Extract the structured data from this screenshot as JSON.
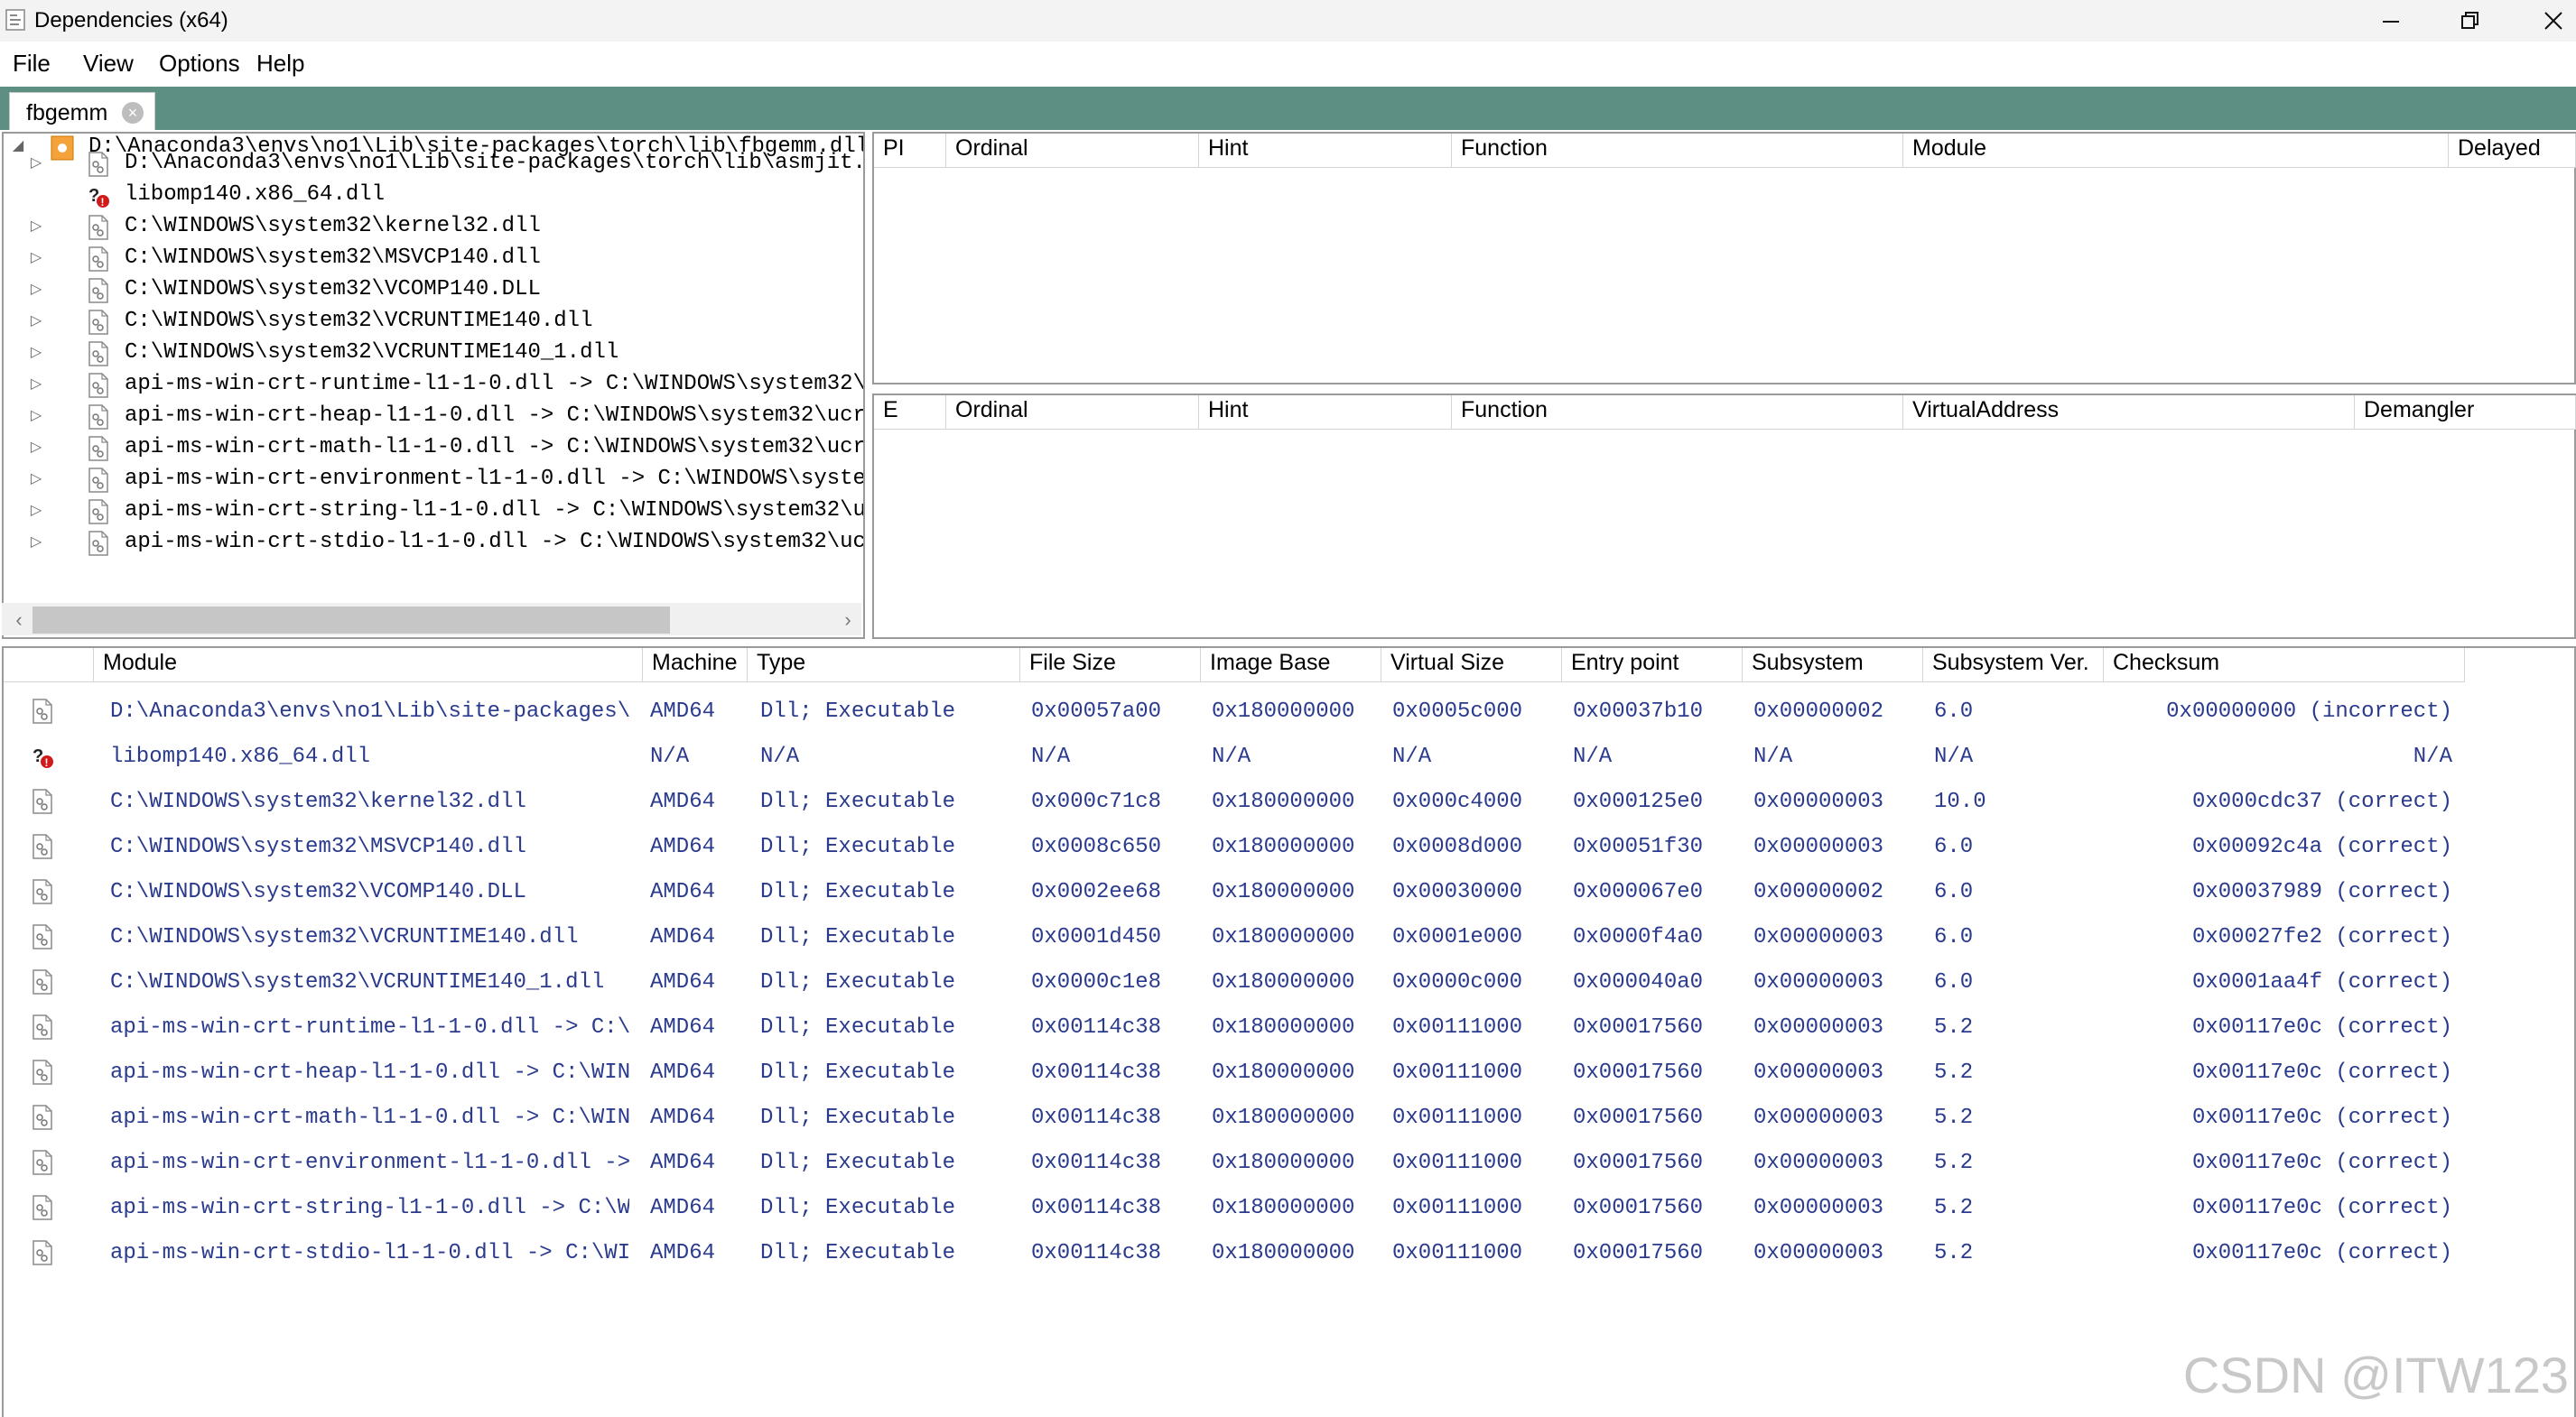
{
  "window": {
    "title": "Dependencies (x64)",
    "buttons": {
      "minimize": "—",
      "restore": "❐",
      "close": "✕"
    }
  },
  "menu": [
    "File",
    "View",
    "Options",
    "Help"
  ],
  "tab": {
    "label": "fbgemm"
  },
  "tree": {
    "root": "D:\\Anaconda3\\envs\\no1\\Lib\\site-packages\\torch\\lib\\fbgemm.dll",
    "children": [
      {
        "text": "D:\\Anaconda3\\envs\\no1\\Lib\\site-packages\\torch\\lib\\asmjit.",
        "expandable": true,
        "missing": false
      },
      {
        "text": "libomp140.x86_64.dll",
        "expandable": false,
        "missing": true
      },
      {
        "text": "C:\\WINDOWS\\system32\\kernel32.dll",
        "expandable": true,
        "missing": false
      },
      {
        "text": "C:\\WINDOWS\\system32\\MSVCP140.dll",
        "expandable": true,
        "missing": false
      },
      {
        "text": "C:\\WINDOWS\\system32\\VCOMP140.DLL",
        "expandable": true,
        "missing": false
      },
      {
        "text": "C:\\WINDOWS\\system32\\VCRUNTIME140.dll",
        "expandable": true,
        "missing": false
      },
      {
        "text": "C:\\WINDOWS\\system32\\VCRUNTIME140_1.dll",
        "expandable": true,
        "missing": false
      },
      {
        "text": "api-ms-win-crt-runtime-l1-1-0.dll -> C:\\WINDOWS\\system32\\",
        "expandable": true,
        "missing": false
      },
      {
        "text": "api-ms-win-crt-heap-l1-1-0.dll -> C:\\WINDOWS\\system32\\ucr",
        "expandable": true,
        "missing": false
      },
      {
        "text": "api-ms-win-crt-math-l1-1-0.dll -> C:\\WINDOWS\\system32\\ucr",
        "expandable": true,
        "missing": false
      },
      {
        "text": "api-ms-win-crt-environment-l1-1-0.dll -> C:\\WINDOWS\\syste",
        "expandable": true,
        "missing": false
      },
      {
        "text": "api-ms-win-crt-string-l1-1-0.dll -> C:\\WINDOWS\\system32\\u",
        "expandable": true,
        "missing": false
      },
      {
        "text": "api-ms-win-crt-stdio-l1-1-0.dll -> C:\\WINDOWS\\system32\\uc",
        "expandable": true,
        "missing": false
      }
    ]
  },
  "imports": {
    "columns": [
      "PI",
      "Ordinal",
      "Hint",
      "Function",
      "Module",
      "Delayed"
    ]
  },
  "exports": {
    "columns": [
      "E",
      "Ordinal",
      "Hint",
      "Function",
      "VirtualAddress",
      "Demangler"
    ]
  },
  "modules": {
    "columns": [
      "Module",
      "Machine",
      "Type",
      "File Size",
      "Image Base",
      "Virtual Size",
      "Entry point",
      "Subsystem",
      "Subsystem Ver.",
      "Checksum"
    ],
    "rows": [
      {
        "missing": false,
        "cells": [
          "D:\\Anaconda3\\envs\\no1\\Lib\\site-packages\\",
          "AMD64",
          "Dll; Executable",
          "0x00057a00",
          "0x180000000",
          "0x0005c000",
          "0x00037b10",
          "0x00000002",
          "6.0",
          "0x00000000 (incorrect)"
        ]
      },
      {
        "missing": true,
        "cells": [
          "libomp140.x86_64.dll",
          "N/A",
          "N/A",
          "N/A",
          "N/A",
          "N/A",
          "N/A",
          "N/A",
          "N/A",
          "N/A"
        ]
      },
      {
        "missing": false,
        "cells": [
          "C:\\WINDOWS\\system32\\kernel32.dll",
          "AMD64",
          "Dll; Executable",
          "0x000c71c8",
          "0x180000000",
          "0x000c4000",
          "0x000125e0",
          "0x00000003",
          "10.0",
          "0x000cdc37 (correct)"
        ]
      },
      {
        "missing": false,
        "cells": [
          "C:\\WINDOWS\\system32\\MSVCP140.dll",
          "AMD64",
          "Dll; Executable",
          "0x0008c650",
          "0x180000000",
          "0x0008d000",
          "0x00051f30",
          "0x00000003",
          "6.0",
          "0x00092c4a (correct)"
        ]
      },
      {
        "missing": false,
        "cells": [
          "C:\\WINDOWS\\system32\\VCOMP140.DLL",
          "AMD64",
          "Dll; Executable",
          "0x0002ee68",
          "0x180000000",
          "0x00030000",
          "0x000067e0",
          "0x00000002",
          "6.0",
          "0x00037989 (correct)"
        ]
      },
      {
        "missing": false,
        "cells": [
          "C:\\WINDOWS\\system32\\VCRUNTIME140.dll",
          "AMD64",
          "Dll; Executable",
          "0x0001d450",
          "0x180000000",
          "0x0001e000",
          "0x0000f4a0",
          "0x00000003",
          "6.0",
          "0x00027fe2 (correct)"
        ]
      },
      {
        "missing": false,
        "cells": [
          "C:\\WINDOWS\\system32\\VCRUNTIME140_1.dll",
          "AMD64",
          "Dll; Executable",
          "0x0000c1e8",
          "0x180000000",
          "0x0000c000",
          "0x000040a0",
          "0x00000003",
          "6.0",
          "0x0001aa4f (correct)"
        ]
      },
      {
        "missing": false,
        "cells": [
          "api-ms-win-crt-runtime-l1-1-0.dll -> C:\\",
          "AMD64",
          "Dll; Executable",
          "0x00114c38",
          "0x180000000",
          "0x00111000",
          "0x00017560",
          "0x00000003",
          "5.2",
          "0x00117e0c (correct)"
        ]
      },
      {
        "missing": false,
        "cells": [
          "api-ms-win-crt-heap-l1-1-0.dll -> C:\\WIN",
          "AMD64",
          "Dll; Executable",
          "0x00114c38",
          "0x180000000",
          "0x00111000",
          "0x00017560",
          "0x00000003",
          "5.2",
          "0x00117e0c (correct)"
        ]
      },
      {
        "missing": false,
        "cells": [
          "api-ms-win-crt-math-l1-1-0.dll -> C:\\WIN",
          "AMD64",
          "Dll; Executable",
          "0x00114c38",
          "0x180000000",
          "0x00111000",
          "0x00017560",
          "0x00000003",
          "5.2",
          "0x00117e0c (correct)"
        ]
      },
      {
        "missing": false,
        "cells": [
          "api-ms-win-crt-environment-l1-1-0.dll ->",
          "AMD64",
          "Dll; Executable",
          "0x00114c38",
          "0x180000000",
          "0x00111000",
          "0x00017560",
          "0x00000003",
          "5.2",
          "0x00117e0c (correct)"
        ]
      },
      {
        "missing": false,
        "cells": [
          "api-ms-win-crt-string-l1-1-0.dll -> C:\\W",
          "AMD64",
          "Dll; Executable",
          "0x00114c38",
          "0x180000000",
          "0x00111000",
          "0x00017560",
          "0x00000003",
          "5.2",
          "0x00117e0c (correct)"
        ]
      },
      {
        "missing": false,
        "cells": [
          "api-ms-win-crt-stdio-l1-1-0.dll -> C:\\WI",
          "AMD64",
          "Dll; Executable",
          "0x00114c38",
          "0x180000000",
          "0x00111000",
          "0x00017560",
          "0x00000003",
          "5.2",
          "0x00117e0c (correct)"
        ]
      }
    ]
  },
  "watermark": "CSDN @ITW123",
  "icons": {
    "module": "dll-file-icon",
    "missing": "missing-module-icon",
    "root": "root-dll-icon"
  },
  "colors": {
    "accent": "#5d8f82",
    "moduleText": "#2a3a8c",
    "missingBadge": "#d11a1a"
  }
}
